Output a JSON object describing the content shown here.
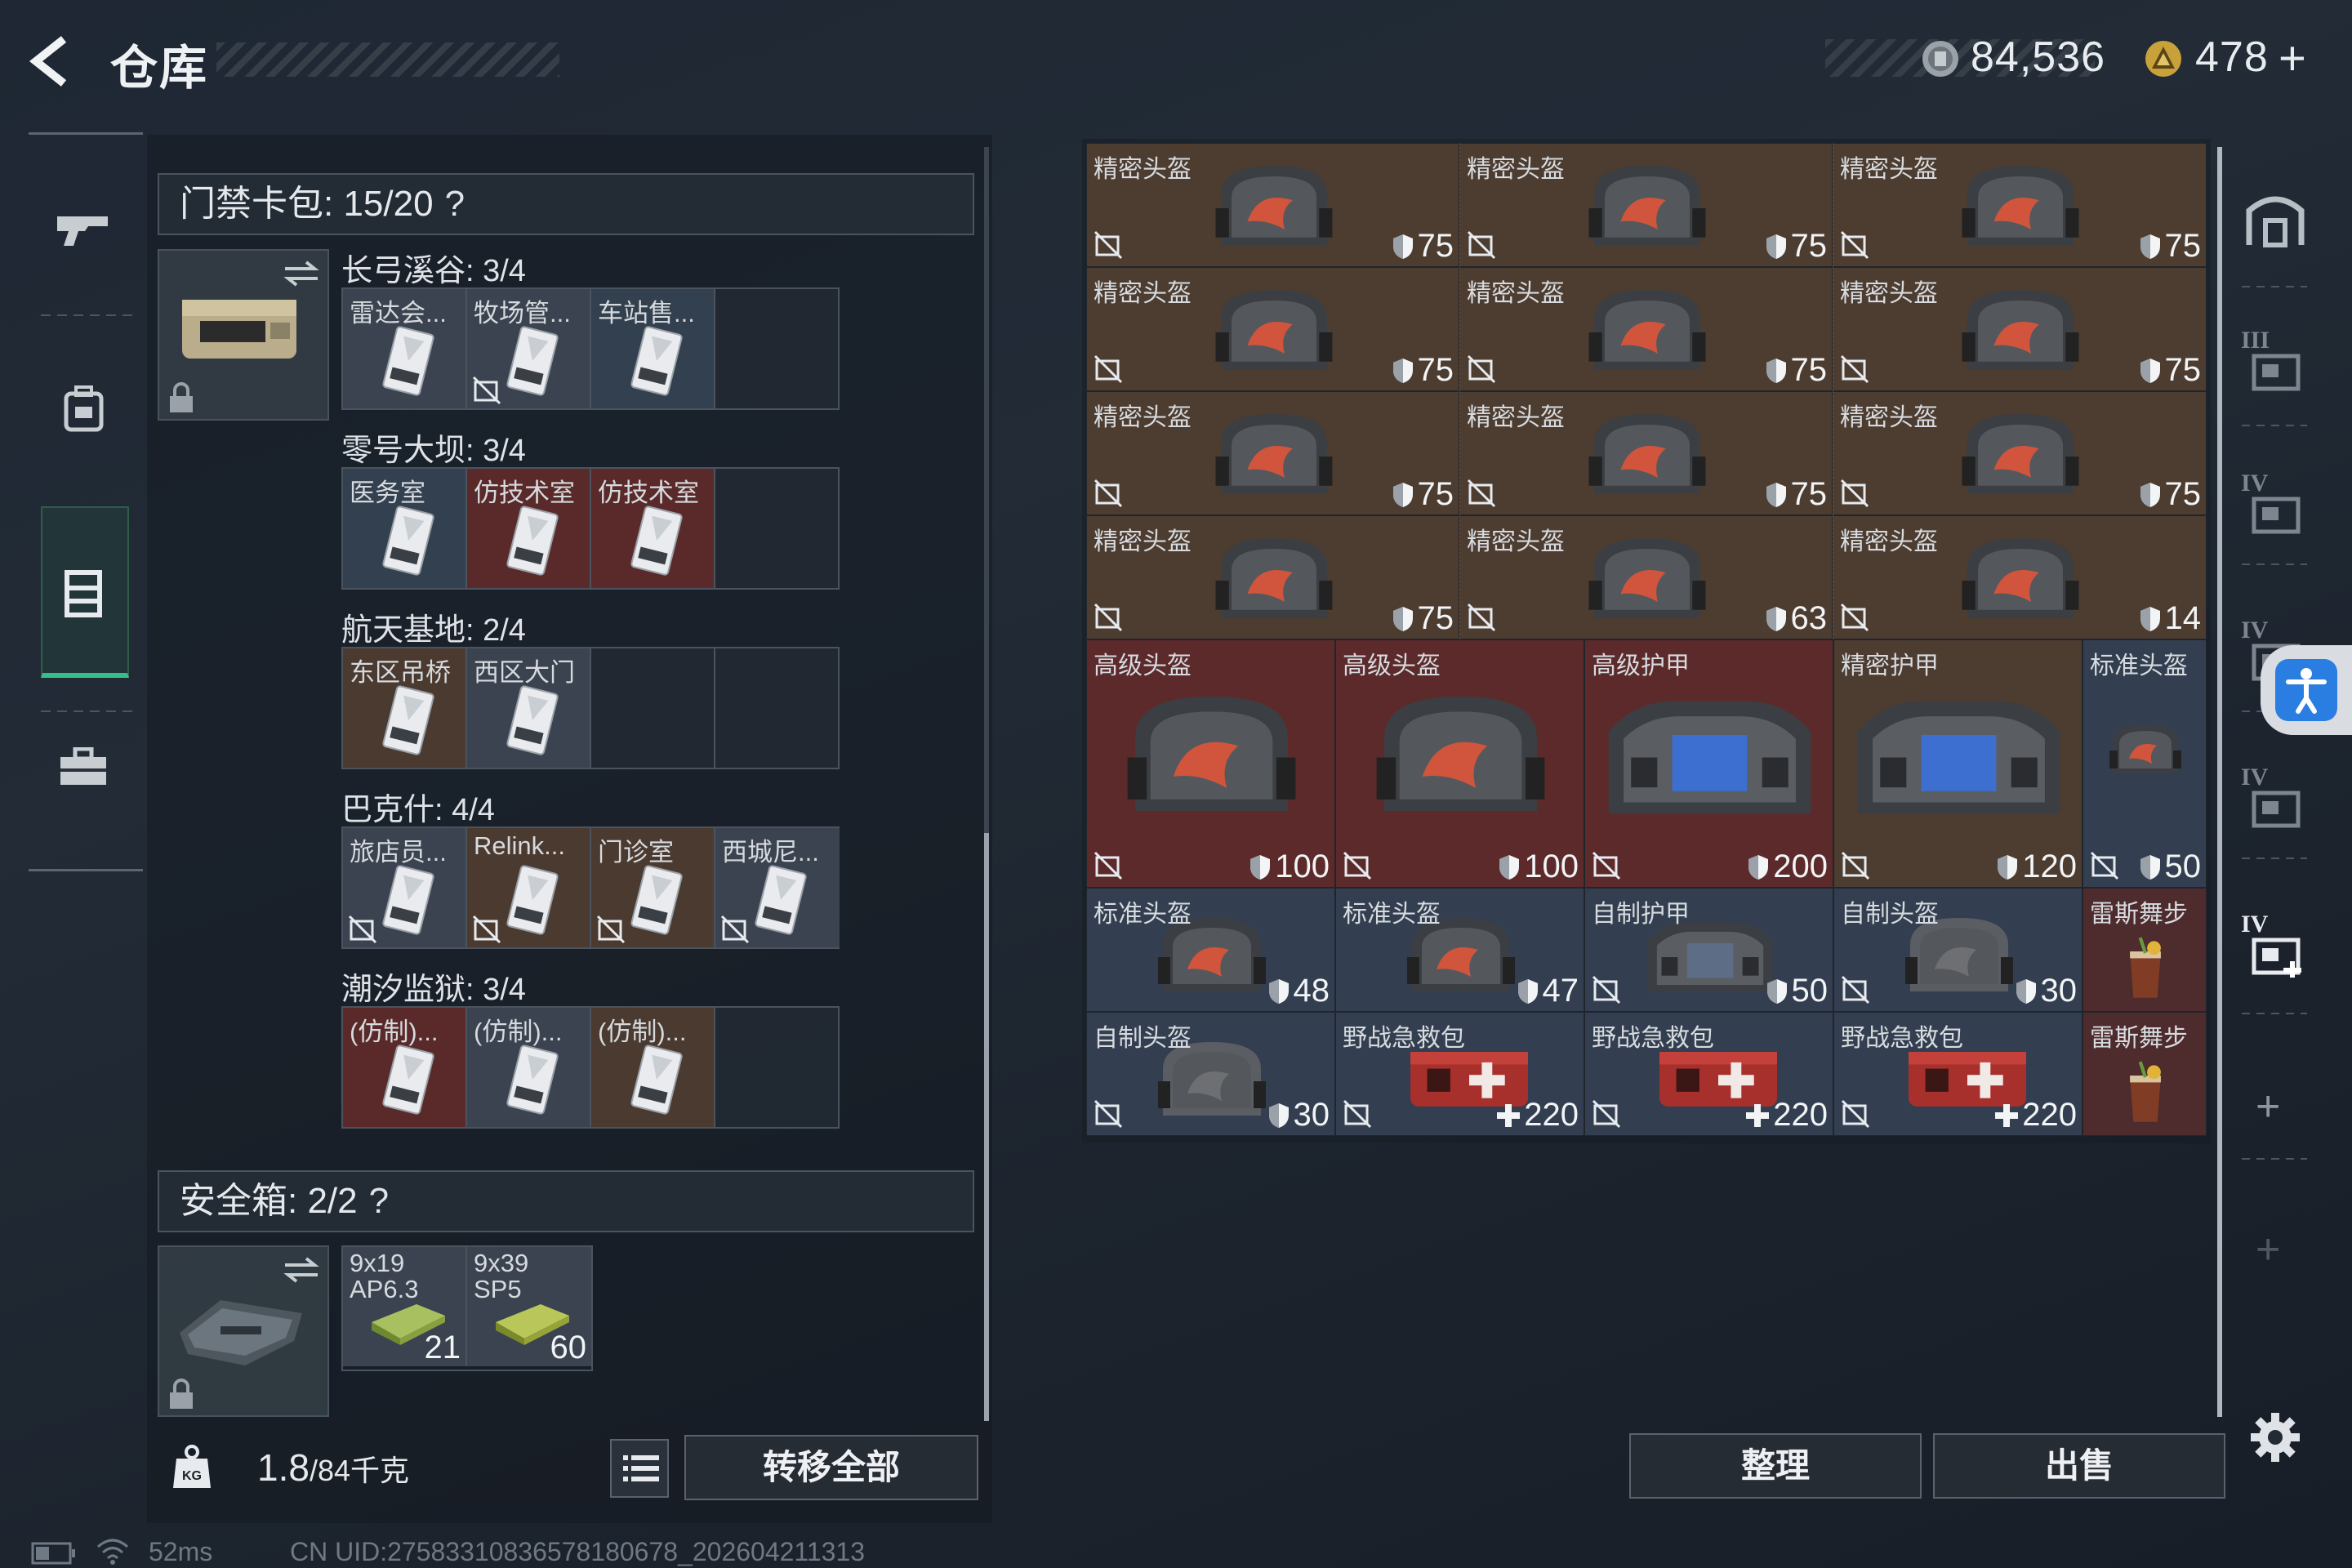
{
  "header": {
    "title": "仓库",
    "currency1": "84,536",
    "currency2": "478",
    "plus": "+"
  },
  "left": {
    "keycard_title": "门禁卡包: 15/20",
    "safebox_title": "安全箱: 2/2",
    "help": "?",
    "groups": [
      {
        "title": "长弓溪谷: 3/4",
        "slots": [
          {
            "label": "雷达会...",
            "bg": "gray",
            "nolock": false
          },
          {
            "label": "牧场管...",
            "bg": "gray",
            "nolock": true
          },
          {
            "label": "车站售...",
            "bg": "blue",
            "nolock": false
          },
          {
            "label": "",
            "bg": "empty",
            "nolock": false
          }
        ]
      },
      {
        "title": "零号大坝: 3/4",
        "slots": [
          {
            "label": "医务室",
            "bg": "blue",
            "nolock": false
          },
          {
            "label": "仿技术室",
            "bg": "red",
            "nolock": false
          },
          {
            "label": "仿技术室",
            "bg": "red",
            "nolock": false
          },
          {
            "label": "",
            "bg": "empty",
            "nolock": false
          }
        ]
      },
      {
        "title": "航天基地: 2/4",
        "slots": [
          {
            "label": "东区吊桥",
            "bg": "brown",
            "nolock": false
          },
          {
            "label": "西区大门",
            "bg": "gray",
            "nolock": false
          },
          {
            "label": "",
            "bg": "empty",
            "nolock": false
          },
          {
            "label": "",
            "bg": "empty",
            "nolock": false
          }
        ]
      },
      {
        "title": "巴克什: 4/4",
        "slots": [
          {
            "label": "旅店员...",
            "bg": "gray",
            "nolock": true
          },
          {
            "label": "Relink...",
            "bg": "brown",
            "nolock": true
          },
          {
            "label": "门诊室",
            "bg": "brown",
            "nolock": true
          },
          {
            "label": "西城尼...",
            "bg": "gray",
            "nolock": true
          }
        ]
      },
      {
        "title": "潮汐监狱: 3/4",
        "slots": [
          {
            "label": "(仿制)...",
            "bg": "red",
            "nolock": false
          },
          {
            "label": "(仿制)...",
            "bg": "gray",
            "nolock": false
          },
          {
            "label": "(仿制)...",
            "bg": "brown",
            "nolock": false
          },
          {
            "label": "",
            "bg": "empty",
            "nolock": false
          }
        ]
      }
    ],
    "ammo": [
      {
        "label": "9x19 AP6.3",
        "count": "21"
      },
      {
        "label": "9x39 SP5",
        "count": "60"
      }
    ],
    "weight_value": "1.8",
    "weight_max": "/84千克",
    "transfer_all": "转移全部"
  },
  "grid_rows": [
    {
      "items": [
        {
          "label": "精密头盔",
          "value": "75",
          "kind": "shield",
          "bg": "brown",
          "img": "helmet"
        },
        {
          "label": "精密头盔",
          "value": "75",
          "kind": "shield",
          "bg": "brown",
          "img": "helmet"
        },
        {
          "label": "精密头盔",
          "value": "75",
          "kind": "shield",
          "bg": "brown",
          "img": "helmet"
        }
      ]
    },
    {
      "items": [
        {
          "label": "精密头盔",
          "value": "75",
          "kind": "shield",
          "bg": "brown",
          "img": "helmet"
        },
        {
          "label": "精密头盔",
          "value": "75",
          "kind": "shield",
          "bg": "brown",
          "img": "helmet"
        },
        {
          "label": "精密头盔",
          "value": "75",
          "kind": "shield",
          "bg": "brown",
          "img": "helmet"
        }
      ]
    },
    {
      "items": [
        {
          "label": "精密头盔",
          "value": "75",
          "kind": "shield",
          "bg": "brown",
          "img": "helmet"
        },
        {
          "label": "精密头盔",
          "value": "75",
          "kind": "shield",
          "bg": "brown",
          "img": "helmet"
        },
        {
          "label": "精密头盔",
          "value": "75",
          "kind": "shield",
          "bg": "brown",
          "img": "helmet"
        }
      ]
    },
    {
      "items": [
        {
          "label": "精密头盔",
          "value": "75",
          "kind": "shield",
          "bg": "brown",
          "img": "helmet"
        },
        {
          "label": "精密头盔",
          "value": "63",
          "kind": "shield",
          "bg": "brown",
          "img": "helmet"
        },
        {
          "label": "精密头盔",
          "value": "14",
          "kind": "shield",
          "bg": "brown",
          "img": "helmet"
        }
      ]
    },
    {
      "items": [
        {
          "label": "高级头盔",
          "value": "100",
          "kind": "shield",
          "bg": "red",
          "img": "helmet"
        },
        {
          "label": "高级头盔",
          "value": "100",
          "kind": "shield",
          "bg": "red",
          "img": "helmet"
        },
        {
          "label": "高级护甲",
          "value": "200",
          "kind": "shield",
          "bg": "red",
          "img": "armor"
        },
        {
          "label": "精密护甲",
          "value": "120",
          "kind": "shield",
          "bg": "brown",
          "img": "armor"
        },
        {
          "label": "标准头盔",
          "value": "50",
          "kind": "shield",
          "bg": "blue",
          "img": "helmet-small"
        }
      ]
    },
    {
      "items": [
        {
          "label": "标准头盔",
          "value": "48",
          "kind": "shield",
          "bg": "blue",
          "img": "helmet"
        },
        {
          "label": "标准头盔",
          "value": "47",
          "kind": "shield",
          "bg": "blue",
          "img": "helmet"
        },
        {
          "label": "自制护甲",
          "value": "50",
          "kind": "shield",
          "bg": "blue",
          "img": "armor-gray"
        },
        {
          "label": "自制头盔",
          "value": "30",
          "kind": "shield",
          "bg": "blue",
          "img": "helmet-gray"
        },
        {
          "label": "雷斯舞步",
          "value": "",
          "kind": "none",
          "bg": "red",
          "img": "drink"
        }
      ]
    },
    {
      "items": [
        {
          "label": "自制头盔",
          "value": "30",
          "kind": "shield",
          "bg": "blue",
          "img": "helmet-gray"
        },
        {
          "label": "野战急救包",
          "value": "220",
          "kind": "plus",
          "bg": "blue",
          "img": "medkit"
        },
        {
          "label": "野战急救包",
          "value": "220",
          "kind": "plus",
          "bg": "blue",
          "img": "medkit"
        },
        {
          "label": "野战急救包",
          "value": "220",
          "kind": "plus",
          "bg": "blue",
          "img": "medkit"
        },
        {
          "label": "雷斯舞步",
          "value": "",
          "kind": "none",
          "bg": "red",
          "img": "drink"
        }
      ]
    }
  ],
  "buttons": {
    "sort": "整理",
    "sell": "出售"
  },
  "status": {
    "ping": "52ms",
    "uid": "CN UID:27583310836578180678_202604211313"
  },
  "rightnav_tiers": [
    "III",
    "IV",
    "IV",
    "IV",
    "IV"
  ]
}
